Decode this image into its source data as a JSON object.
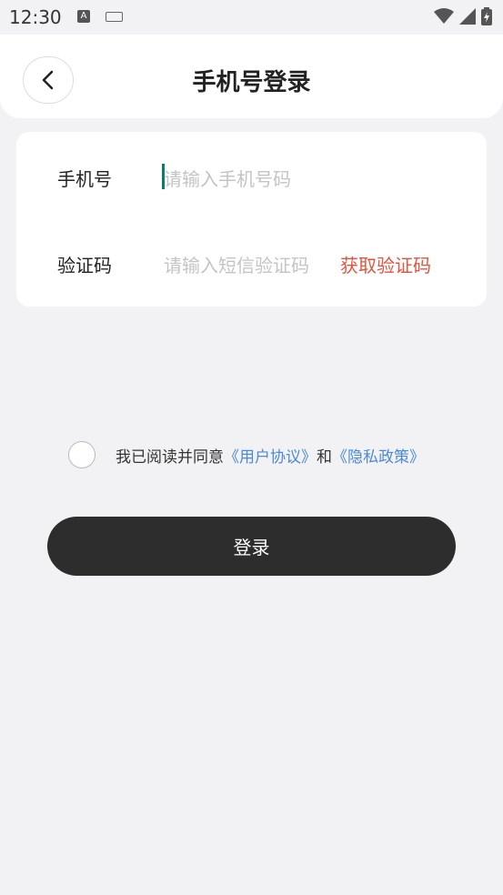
{
  "status_bar": {
    "time": "12:30",
    "a_badge": "A"
  },
  "header": {
    "title": "手机号登录"
  },
  "form": {
    "phone_label": "手机号",
    "phone_placeholder": "请输入手机号码",
    "code_label": "验证码",
    "code_placeholder": "请输入短信验证码",
    "get_code_label": "获取验证码"
  },
  "agreement": {
    "prefix": "我已阅读并同意",
    "user_agreement": "《用户协议》",
    "conjunction": "和",
    "privacy_policy": "《隐私政策》",
    "checked": false
  },
  "login_button": "登录",
  "colors": {
    "accent_link": "#4a8ad8",
    "get_code": "#e5533d",
    "button_bg": "#2d2d2d",
    "caret": "#0a7c6c"
  }
}
